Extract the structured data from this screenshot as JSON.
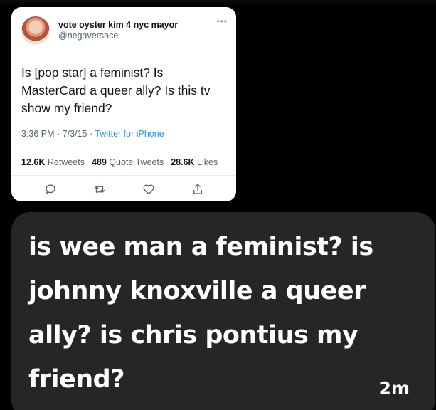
{
  "tweet": {
    "display_name": "vote oyster kim 4 nyc mayor",
    "handle": "@negaversace",
    "more_icon": "ellipsis-icon",
    "text": "Is [pop star] a feminist? Is MasterCard a queer ally? Is this tv show my friend?",
    "time": "3:36 PM",
    "date": "7/3/15",
    "separator": "·",
    "source": "Twitter for iPhone",
    "stats": {
      "retweets_count": "12.6K",
      "retweets_label": "Retweets",
      "quotes_count": "489",
      "quotes_label": "Quote Tweets",
      "likes_count": "28.6K",
      "likes_label": "Likes"
    },
    "actions": [
      "reply-icon",
      "retweet-icon",
      "like-icon",
      "share-icon"
    ]
  },
  "comment": {
    "text": "is wee man a feminist? is johnny knoxville a queer ally? is chris pontius my friend?",
    "timestamp": "2m"
  },
  "colors": {
    "background": "#000000",
    "bubble": "#262626",
    "link_blue": "#1d9bf0",
    "muted_gray": "#536471"
  }
}
